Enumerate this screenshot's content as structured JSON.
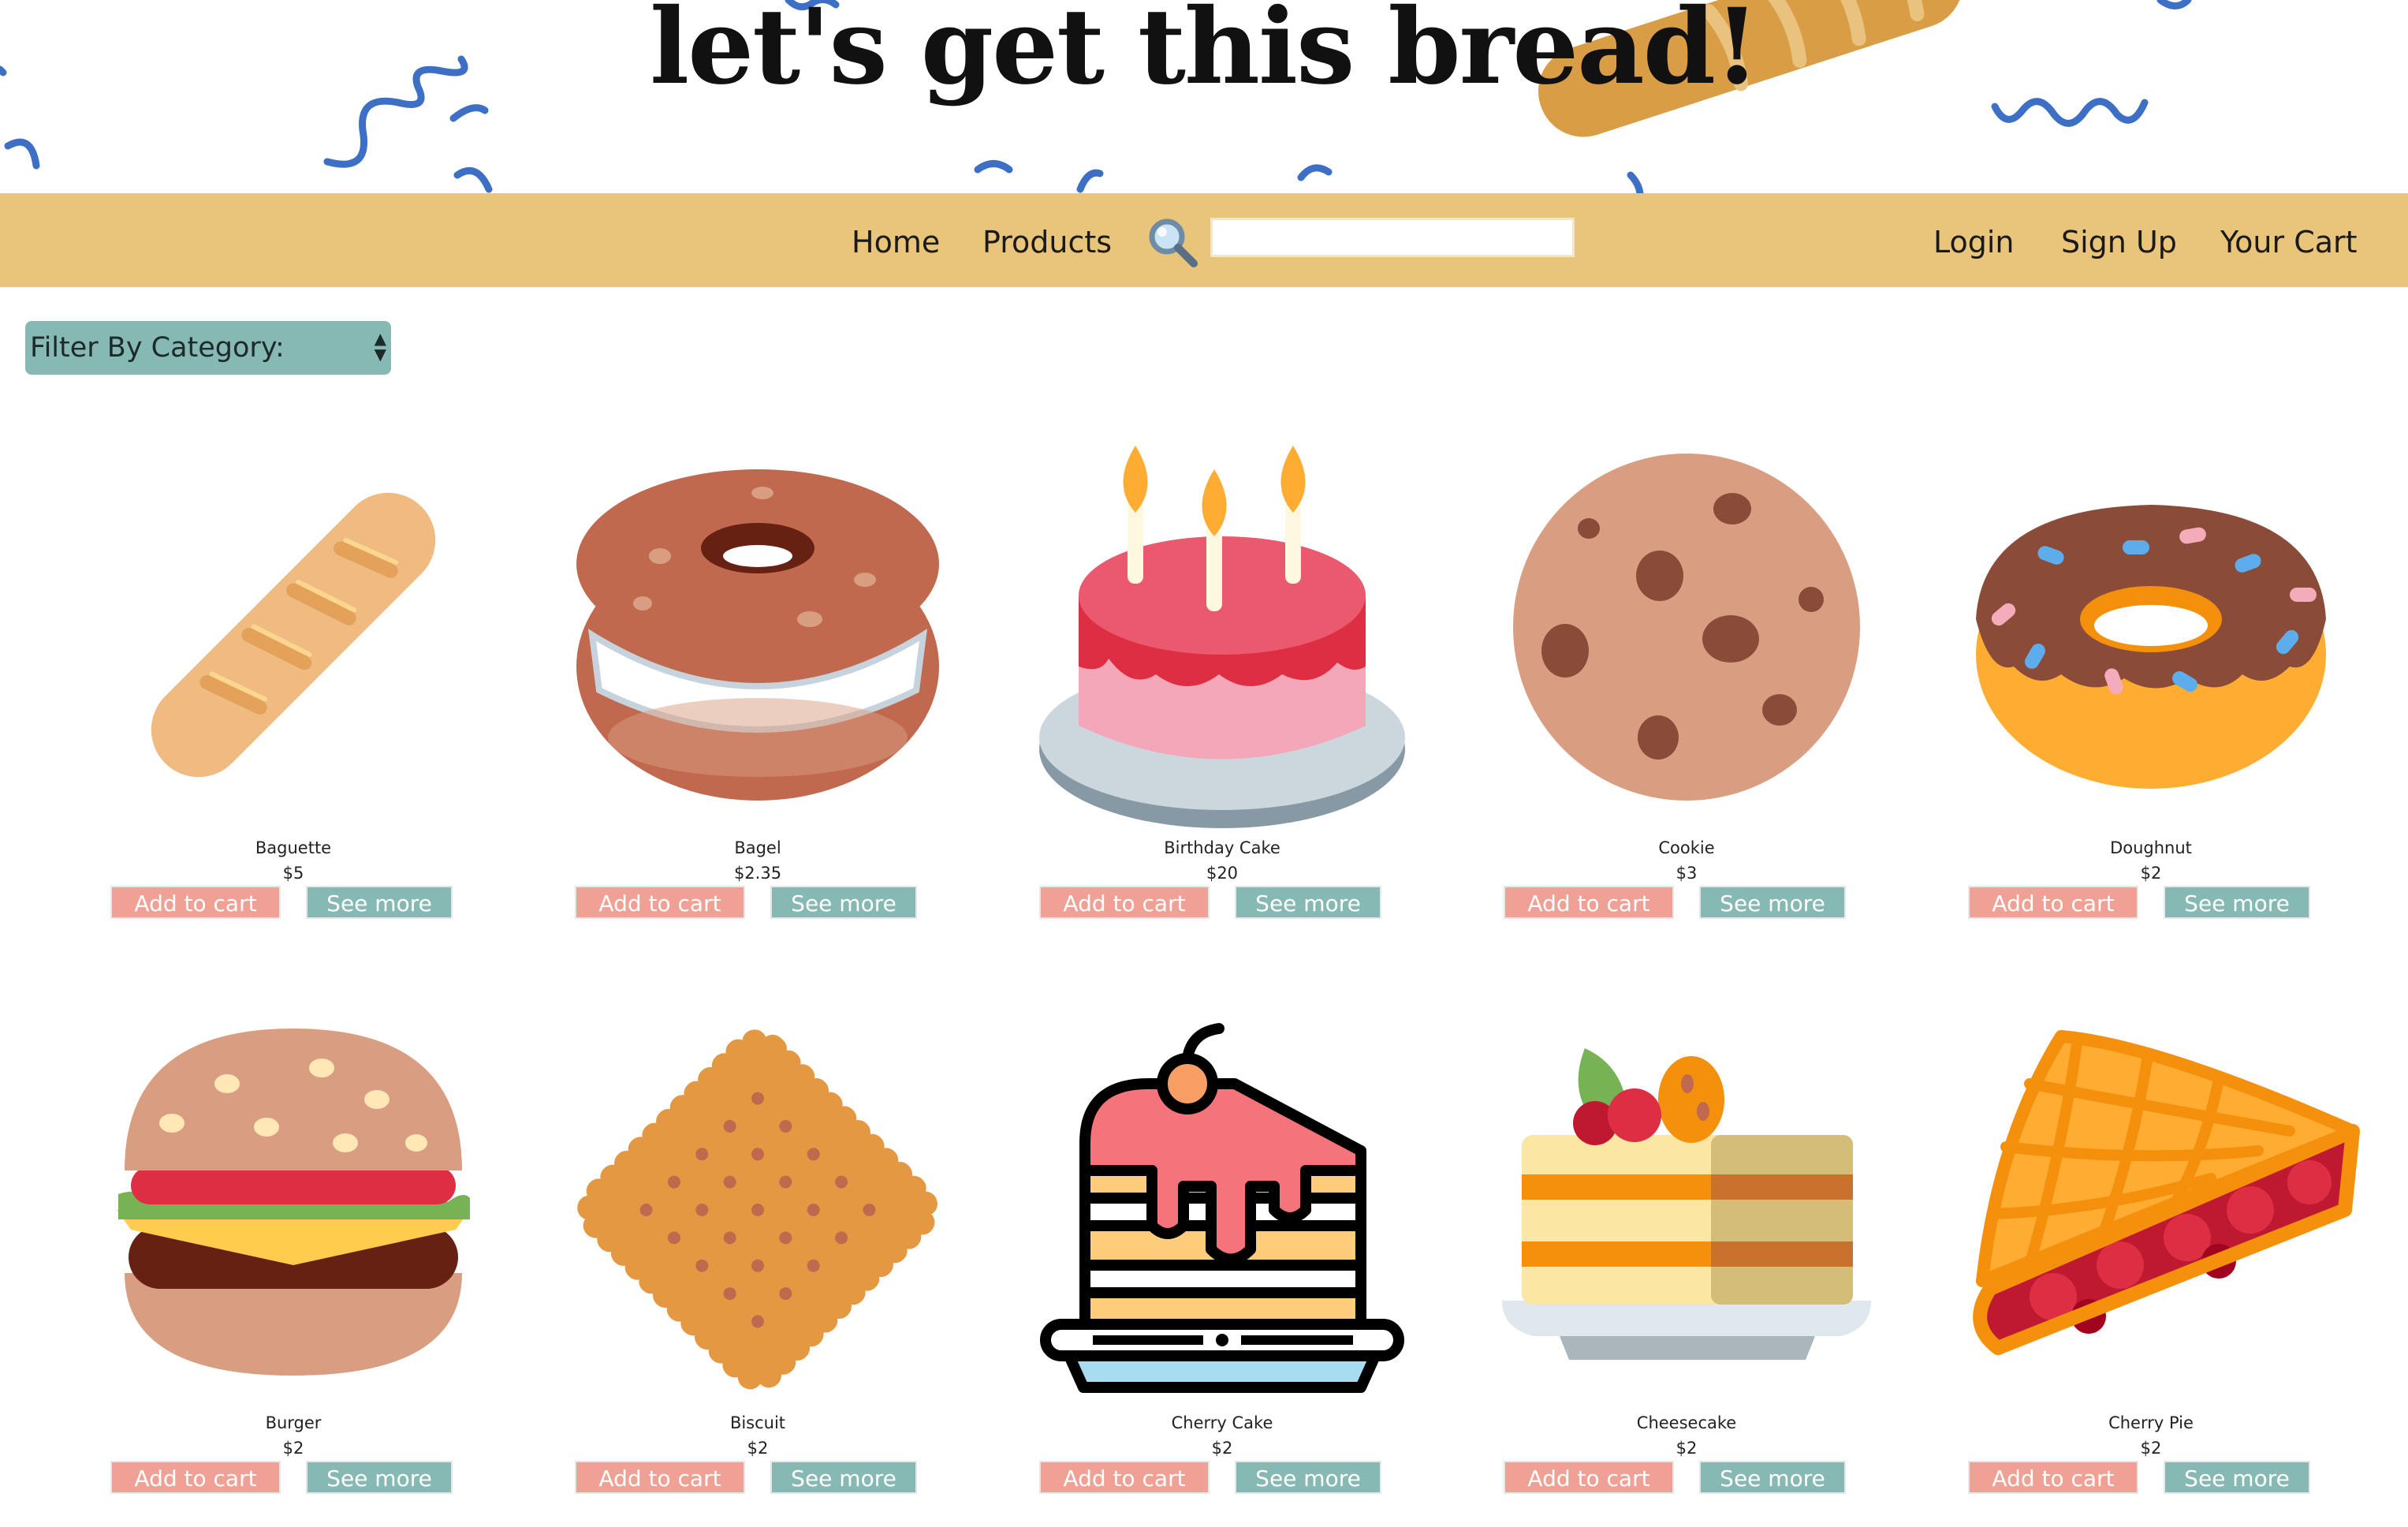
{
  "header": {
    "title": "let's get this bread!"
  },
  "nav": {
    "home": "Home",
    "products": "Products",
    "search_value": "",
    "login": "Login",
    "signup": "Sign Up",
    "cart": "Your Cart"
  },
  "filter": {
    "label": "Filter By Category:",
    "arrows": "▲▼"
  },
  "buttons": {
    "add": "Add to cart",
    "more": "See more"
  },
  "products": [
    {
      "name": "Baguette",
      "price": "$5",
      "icon": "baguette-icon"
    },
    {
      "name": "Bagel",
      "price": "$2.35",
      "icon": "bagel-icon"
    },
    {
      "name": "Birthday Cake",
      "price": "$20",
      "icon": "birthday-cake-icon"
    },
    {
      "name": "Cookie",
      "price": "$3",
      "icon": "cookie-icon"
    },
    {
      "name": "Doughnut",
      "price": "$2",
      "icon": "doughnut-icon"
    },
    {
      "name": "Burger",
      "price": "$2",
      "icon": "burger-icon"
    },
    {
      "name": "Biscuit",
      "price": "$2",
      "icon": "biscuit-icon"
    },
    {
      "name": "Cherry Cake",
      "price": "$2",
      "icon": "cherry-cake-icon"
    },
    {
      "name": "Cheesecake",
      "price": "$2",
      "icon": "cheesecake-icon"
    },
    {
      "name": "Cherry Pie",
      "price": "$2",
      "icon": "cherry-pie-icon"
    }
  ],
  "colors": {
    "nav_bg": "#e8c57b",
    "add_button": "#f0a195",
    "more_button": "#86b9b3",
    "squiggle": "#3d6fc4"
  }
}
